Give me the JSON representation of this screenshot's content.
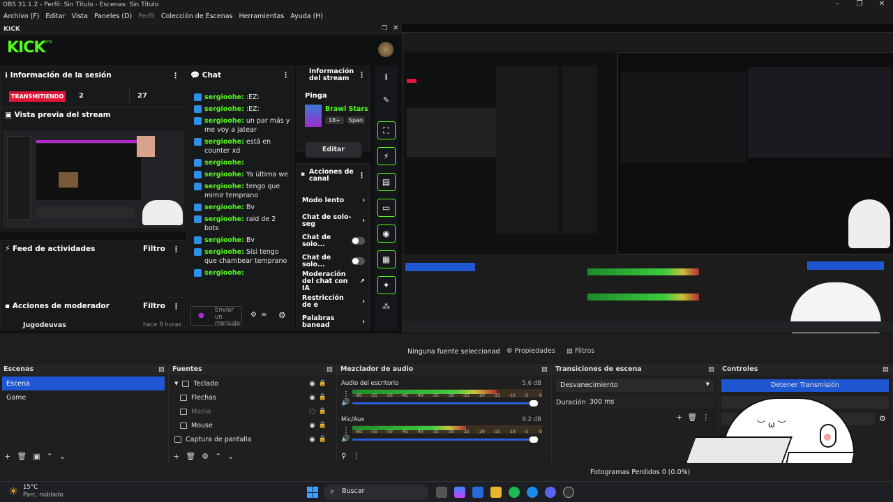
{
  "window": {
    "title": "OBS 31.1.2 - Perfil: Sin Título - Escenas: Sin Título"
  },
  "menu": [
    "Archivo (F)",
    "Editar",
    "Vista",
    "Paneles (D)",
    "Perfil",
    "Colección de Escenas",
    "Herramientas",
    "Ayuda (H)"
  ],
  "kick": {
    "dock_title": "KICK",
    "logo": "KICK",
    "logo_beta": "BETA",
    "session": {
      "title": "Información de la sesión",
      "live_badge": "TRANSMITIENDO",
      "viewers": "2",
      "followers": "27"
    },
    "preview_title": "Vista previa del stream",
    "activity": {
      "title": "Feed de actividades",
      "filter": "Filtro"
    },
    "moderator": {
      "title": "Acciones de moderador",
      "filter": "Filtro",
      "entry_name": "Jugodeuvas",
      "entry_time": "hace 8 horas"
    },
    "chat": {
      "title": "Chat",
      "input_placeholder": "Enviar un mensaje",
      "messages": [
        {
          "user": "sergioohe:",
          "text": ":EZ:"
        },
        {
          "user": "sergioohe:",
          "text": ":EZ:"
        },
        {
          "user": "sergioohe:",
          "text": "un par más y me voy a jatear"
        },
        {
          "user": "sergioohe:",
          "text": "está en counter xd"
        },
        {
          "user": "sergioohe:",
          "text": ""
        },
        {
          "user": "sergioohe:",
          "text": "Ya última we"
        },
        {
          "user": "sergioohe:",
          "text": "tengo que mimir temprano"
        },
        {
          "user": "sergioohe:",
          "text": "Bv"
        },
        {
          "user": "sergioohe:",
          "text": "raid de 2 bots"
        },
        {
          "user": "sergioohe:",
          "text": "Bv"
        },
        {
          "user": "sergioohe:",
          "text": "Sisi tengo que chambear temprano"
        },
        {
          "user": "sergioohe:",
          "text": ""
        }
      ]
    },
    "stream_info": {
      "title": "Información del stream",
      "stream_name": "Pinga",
      "game": "Brawl Stars",
      "tag1": "18+",
      "tag2": "Span",
      "edit_button": "Editar"
    },
    "channel_actions": {
      "title": "Acciones de canal",
      "items": [
        {
          "label": "Modo lento",
          "control": "chevron"
        },
        {
          "label": "Chat de solo-seg",
          "control": "chevron"
        },
        {
          "label": "Chat de solo...",
          "control": "toggle"
        },
        {
          "label": "Chat de solo...",
          "control": "toggle"
        },
        {
          "label": "Moderación del chat con IA",
          "control": "ext"
        },
        {
          "label": "Restricción de e",
          "control": "chevron"
        },
        {
          "label": "Palabras banead",
          "control": "chevron"
        }
      ]
    }
  },
  "preview_status": {
    "no_source": "Ninguna fuente seleccionad",
    "properties": "Propiedades",
    "filters": "Filtros"
  },
  "scenes": {
    "title": "Escenas",
    "items": [
      "Escena",
      "Game"
    ]
  },
  "sources": {
    "title": "Fuentes",
    "items": [
      {
        "label": "Teclado",
        "indent": 0,
        "group": true,
        "hidden": false
      },
      {
        "label": "Flechas",
        "indent": 1,
        "group": false,
        "hidden": false
      },
      {
        "label": "Mania",
        "indent": 1,
        "group": false,
        "hidden": true
      },
      {
        "label": "Mouse",
        "indent": 1,
        "group": false,
        "hidden": false
      },
      {
        "label": "Captura de pantalla",
        "indent": 0,
        "group": false,
        "hidden": false
      }
    ]
  },
  "mixer": {
    "title": "Mezclador de audio",
    "channels": [
      {
        "name": "Audio del escritorio",
        "db": "5.6 dB",
        "level": 0.76
      },
      {
        "name": "Mic/Aux",
        "db": "9.2 dB",
        "level": 0.6
      }
    ],
    "ticks": [
      "-60",
      "-55",
      "-50",
      "-45",
      "-40",
      "-35",
      "-30",
      "-25",
      "-20",
      "-15",
      "-10",
      "-5",
      "0"
    ]
  },
  "transitions": {
    "title": "Transiciones de escena",
    "selected": "Desvanecimiento",
    "duration_label": "Duración",
    "duration_value": "300 ms"
  },
  "controls": {
    "title": "Controles",
    "stop_stream": "Detener Transmisión"
  },
  "status": {
    "dropped_frames": "Fotogramas Perdidos 0 (0.0%)"
  },
  "taskbar": {
    "temp": "15°C",
    "weather": "Parc. nublado",
    "search": "Buscar"
  },
  "colors": {
    "kick_green": "#53fc18",
    "accent_blue": "#1f56d1",
    "live_red": "#e0153a"
  }
}
